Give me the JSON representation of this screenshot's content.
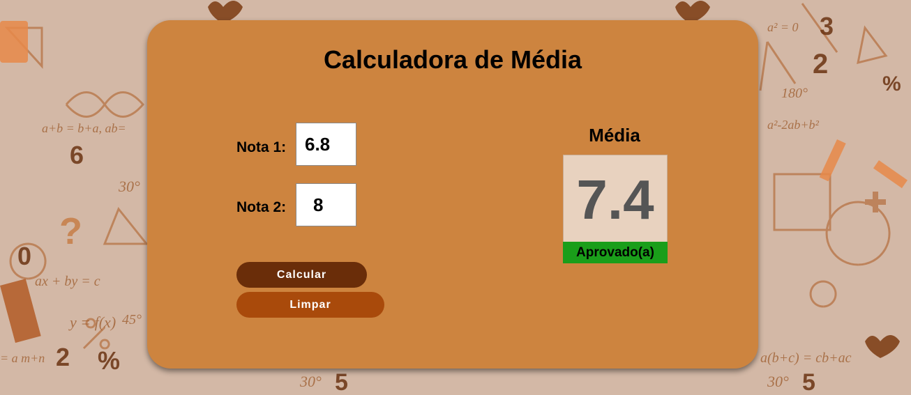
{
  "app": {
    "title": "Calculadora de Média"
  },
  "form": {
    "nota1_label": "Nota 1:",
    "nota1_value": "6.8",
    "nota2_label": "Nota 2:",
    "nota2_value": "8",
    "calcular_label": "Calcular",
    "limpar_label": "Limpar"
  },
  "result": {
    "heading": "Média",
    "value": "7.4",
    "status": "Aprovado(a)"
  },
  "colors": {
    "card": "#cd843f",
    "calcular_button": "#6a2d09",
    "limpar_button": "#a94a0b",
    "status_approved": "#1a9e1a",
    "background": "#d3b8a6"
  }
}
